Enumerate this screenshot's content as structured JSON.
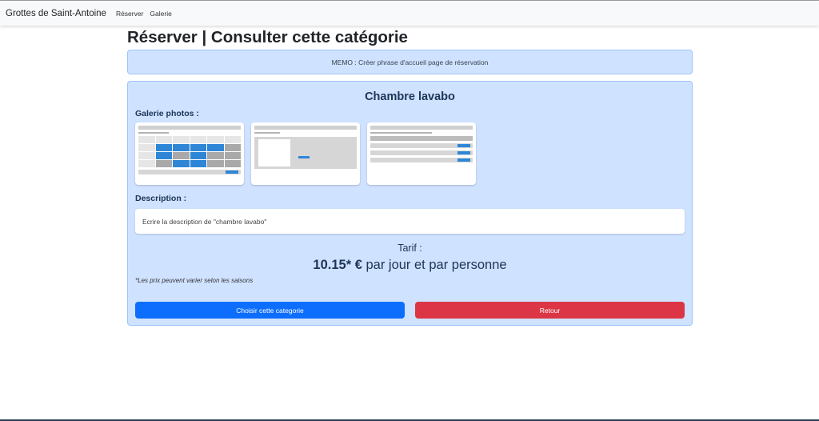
{
  "navbar": {
    "brand": "Grottes de Saint-Antoine",
    "links": [
      "Réserver",
      "Galerie"
    ]
  },
  "page": {
    "title": "Réserver | Consulter cette catégorie",
    "memo": "MEMO : Créer phrase d'accueil page de réservation"
  },
  "category": {
    "name": "Chambre lavabo",
    "gallery_label": "Galerie photos :",
    "description_label": "Description :",
    "description": "Ecrire la description de \"chambre lavabo\"",
    "tarif_label": "Tarif :",
    "price_value": "10.15* €",
    "price_suffix": " par jour et par personne",
    "note": "*Les prix peuvent varier selon les saisons"
  },
  "actions": {
    "choose_label": "Choisir cette categorie",
    "back_label": "Retour"
  },
  "colors": {
    "card_bg": "#cfe2ff",
    "primary": "#0d6efd",
    "danger": "#dc3545"
  }
}
